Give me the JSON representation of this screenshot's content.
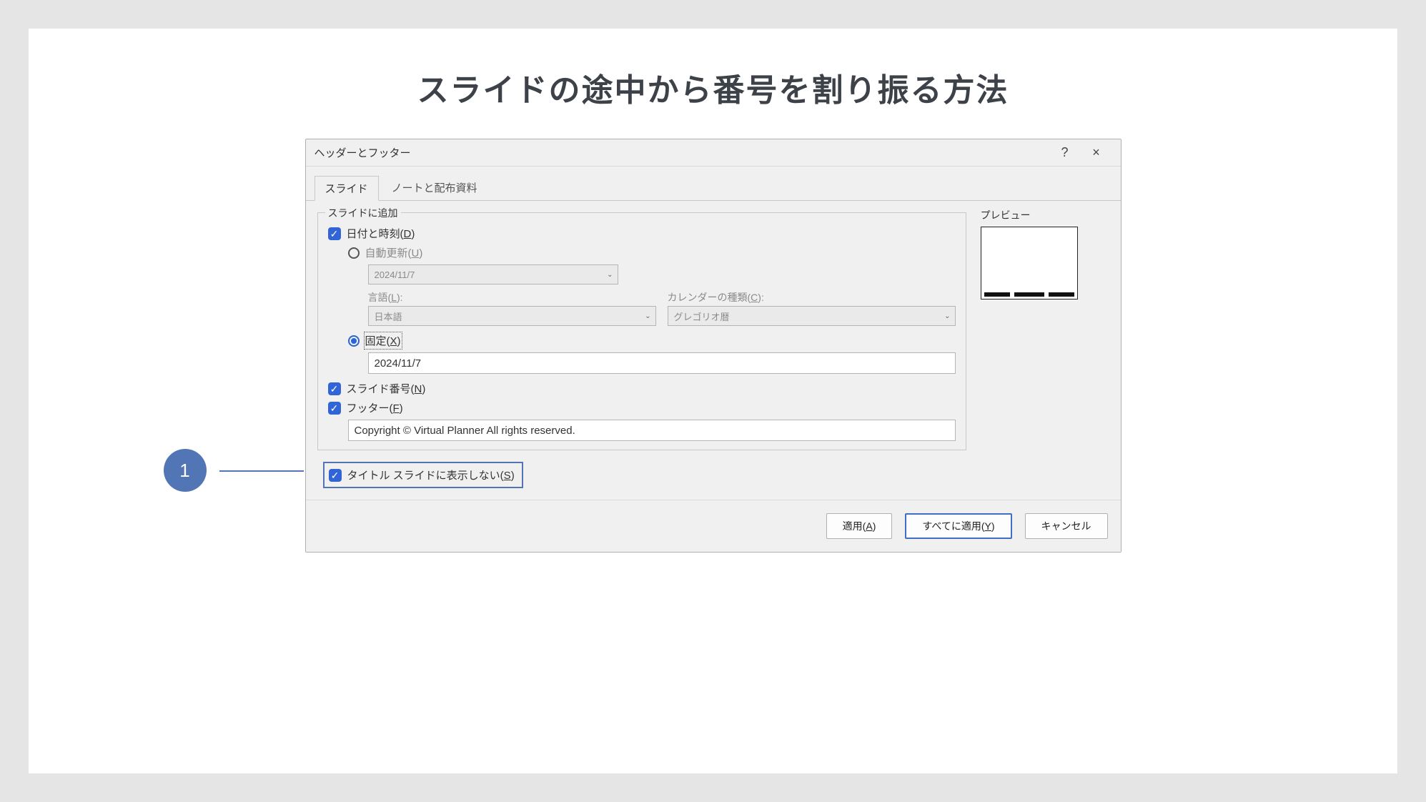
{
  "page": {
    "title": "スライドの途中から番号を割り振る方法"
  },
  "dialog": {
    "title": "ヘッダーとフッター",
    "help": "?",
    "close": "×",
    "tabs": {
      "slide": "スライド",
      "notes": "ノートと配布資料"
    },
    "group": {
      "title": "スライドに追加"
    },
    "dateTime": {
      "label_pre": "日付と時刻(",
      "hotkey": "D",
      "label_post": ")"
    },
    "autoUpdate": {
      "label_pre": "自動更新(",
      "hotkey": "U",
      "label_post": ")",
      "date": "2024/11/7",
      "lang_label_pre": "言語(",
      "lang_hotkey": "L",
      "lang_label_post": "):",
      "lang_value": "日本語",
      "cal_label_pre": "カレンダーの種類(",
      "cal_hotkey": "C",
      "cal_label_post": "):",
      "cal_value": "グレゴリオ暦"
    },
    "fixed": {
      "label_pre": "固定(",
      "hotkey": "X",
      "label_post": ")",
      "value": "2024/11/7"
    },
    "slideNum": {
      "label_pre": "スライド番号(",
      "hotkey": "N",
      "label_post": ")"
    },
    "footer": {
      "label_pre": "フッター(",
      "hotkey": "F",
      "label_post": ")",
      "value": "Copyright © Virtual Planner All rights reserved."
    },
    "hideTitle": {
      "label_pre": "タイトル スライドに表示しない(",
      "hotkey": "S",
      "label_post": ")"
    },
    "preview": {
      "title": "プレビュー"
    },
    "buttons": {
      "apply_pre": "適用(",
      "apply_hot": "A",
      "apply_post": ")",
      "applyAll_pre": "すべてに適用(",
      "applyAll_hot": "Y",
      "applyAll_post": ")",
      "cancel": "キャンセル"
    }
  },
  "callout": {
    "number": "1"
  }
}
